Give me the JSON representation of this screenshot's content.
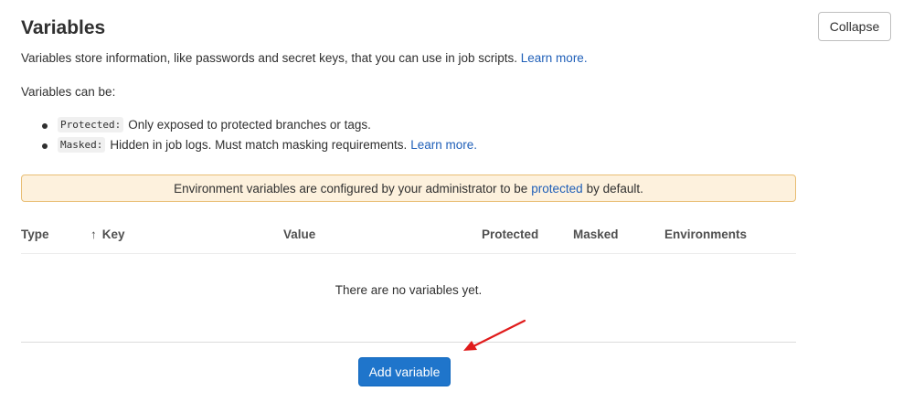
{
  "header": {
    "title": "Variables",
    "collapse_label": "Collapse"
  },
  "intro": {
    "text": "Variables store information, like passwords and secret keys, that you can use in job scripts.",
    "link": "Learn more."
  },
  "can_be": "Variables can be:",
  "bullets": [
    {
      "code": "Protected:",
      "text": "Only exposed to protected branches or tags.",
      "link": ""
    },
    {
      "code": "Masked:",
      "text": "Hidden in job logs. Must match masking requirements.",
      "link": "Learn more."
    }
  ],
  "alert": {
    "before": "Environment variables are configured by your administrator to be",
    "link": "protected",
    "after": "by default."
  },
  "table": {
    "columns": [
      "Type",
      "Key",
      "Value",
      "Protected",
      "Masked",
      "Environments"
    ],
    "sort_icon": "arrow-up-icon",
    "empty_text": "There are no variables yet."
  },
  "add_button_label": "Add variable",
  "colors": {
    "link": "#1f5fb8",
    "primary": "#1f75cb",
    "alert_bg": "#fdf1dd",
    "alert_border": "#e9be74",
    "annotation_arrow": "#e01b1b"
  }
}
